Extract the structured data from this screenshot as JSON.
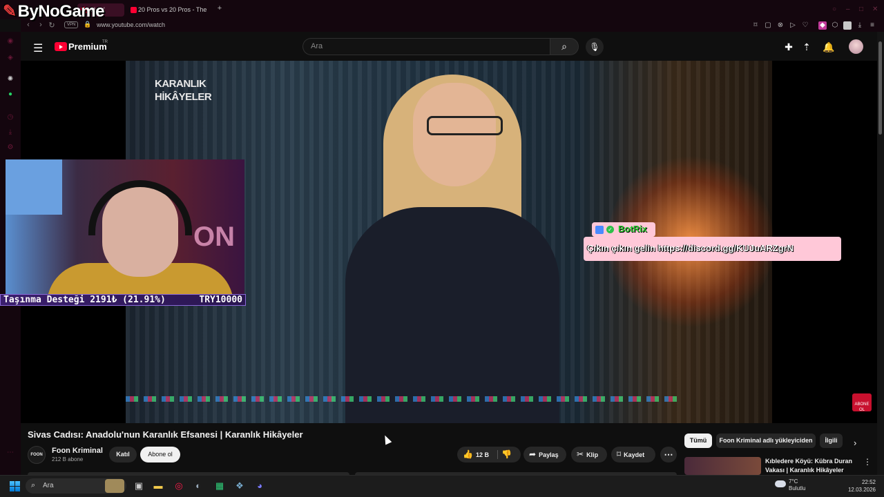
{
  "browser": {
    "overlay_logo": "ByNoGame",
    "tab_active_label": "adolu'",
    "tab_second_label": "20 Pros vs 20 Pros - The",
    "vpn_label": "VPN",
    "url": "www.youtube.com/watch"
  },
  "youtube": {
    "brand": "Premium",
    "brand_region": "TR",
    "search_placeholder": "Ara"
  },
  "video_overlay": {
    "show_title": "KARANLIK HİKÂYELER",
    "donation_goal_text": "Taşınma Desteği 2191₺ (21.91%)",
    "donation_goal_target": "TRY10000",
    "donation_progress_percent": 21.91,
    "chat_bot_name": "BotRix",
    "chat_message": "Çıkın çıkın gelin https://discord.gg/KUJuARZgrN",
    "subscribe_badge": "ABONE OL"
  },
  "video": {
    "title": "Sivas Cadısı: Anadolu'nun Karanlık Efsanesi | Karanlık Hikâyeler",
    "channel_avatar_text": "FOON",
    "channel_name": "Foon Kriminal",
    "subscribers": "212 B abone",
    "join_label": "Katıl",
    "subscribe_label": "Abone ol",
    "likes": "12 B",
    "share_label": "Paylaş",
    "clip_label": "Klip",
    "save_label": "Kaydet"
  },
  "related": {
    "chips": [
      "Tümü",
      "Foon Kriminal adlı yükleyiciden",
      "İlgili"
    ],
    "first_video_title": "Kıbledere Köyü: Kübra Duran Vakası | Karanlık Hikâyeler"
  },
  "taskbar": {
    "search_label": "Ara",
    "weather_temp": "7°C",
    "weather_desc": "Bulutlu",
    "time": "22:52",
    "date": "12.03.2026"
  },
  "colors": {
    "youtube_red": "#ff0033",
    "page_bg": "#0f0f0f",
    "chat_bg": "#ffc8d8",
    "bot_name": "#29c82f",
    "donation_bg": "#3b1f6e"
  }
}
